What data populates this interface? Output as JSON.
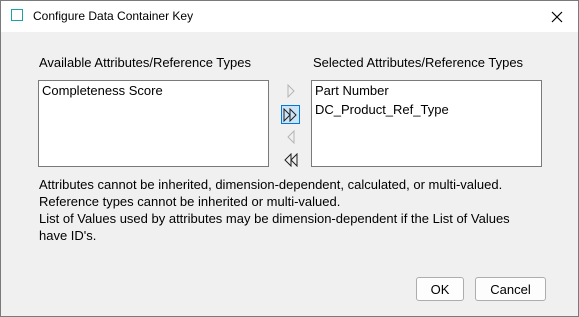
{
  "window": {
    "title": "Configure Data Container Key",
    "icons": {
      "app": "app-square-icon",
      "close": "close-icon"
    }
  },
  "available": {
    "label": "Available Attributes/Reference Types",
    "items": [
      "Completeness Score"
    ]
  },
  "selected": {
    "label": "Selected Attributes/Reference Types",
    "items": [
      "Part Number",
      "DC_Product_Ref_Type"
    ]
  },
  "move_buttons": {
    "move_right_icon": "chevron-right-icon",
    "move_all_right_icon": "double-chevron-right-icon",
    "move_left_icon": "chevron-left-icon",
    "move_all_left_icon": "double-chevron-left-icon"
  },
  "info": {
    "line1": "Attributes cannot be inherited, dimension-dependent, calculated, or multi-valued.",
    "line2": "Reference types cannot be inherited or multi-valued.",
    "line3": "List of Values used by attributes may be dimension-dependent if the List of Values",
    "line4": "have ID's."
  },
  "buttons": {
    "ok": "OK",
    "cancel": "Cancel"
  },
  "colors": {
    "accent": "#0078d7",
    "icon_teal": "#1aa3a3",
    "border": "#7a7a7a"
  }
}
